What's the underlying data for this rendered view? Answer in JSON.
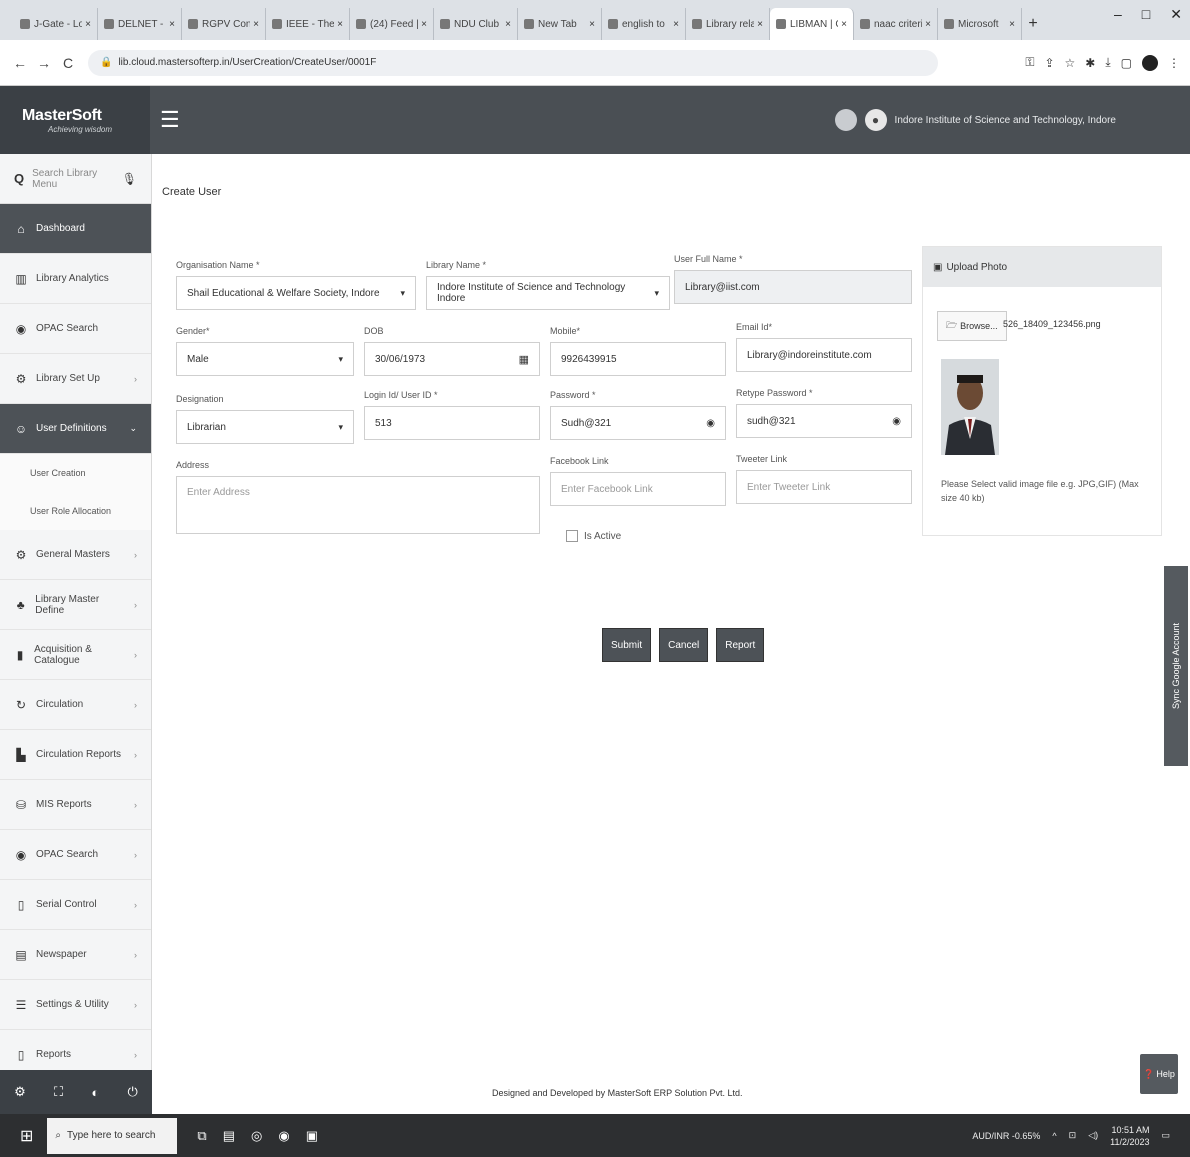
{
  "browser": {
    "tabs": [
      {
        "label": "J-Gate - Lo"
      },
      {
        "label": "DELNET - I"
      },
      {
        "label": "RGPV Cons"
      },
      {
        "label": "IEEE - The"
      },
      {
        "label": "(24) Feed |"
      },
      {
        "label": "NDU Club"
      },
      {
        "label": "New Tab"
      },
      {
        "label": "english to"
      },
      {
        "label": "Library rela"
      },
      {
        "label": "LIBMAN | C"
      },
      {
        "label": "naac criteri"
      },
      {
        "label": "Microsoft"
      }
    ],
    "active_tab_index": 9,
    "url": "lib.cloud.mastersofterp.in/UserCreation/CreateUser/0001F"
  },
  "header": {
    "brand": "MasterSoft",
    "tagline": "Achieving wisdom",
    "institute": "Indore Institute of Science and Technology, Indore"
  },
  "sidebar": {
    "search_placeholder": "Search Library Menu",
    "items": [
      {
        "label": "Dashboard",
        "icon": "home-icon"
      },
      {
        "label": "Library Analytics",
        "icon": "chart-icon"
      },
      {
        "label": "OPAC Search",
        "icon": "search-icon"
      },
      {
        "label": "Library Set Up",
        "icon": "settings-icon"
      },
      {
        "label": "User Definitions",
        "icon": "user-icon"
      },
      {
        "label": "General Masters",
        "icon": "gear-icon"
      },
      {
        "label": "Library Master Define",
        "icon": "users-icon"
      },
      {
        "label": "Acquisition & Catalogue",
        "icon": "book-icon"
      },
      {
        "label": "Circulation",
        "icon": "refresh-icon"
      },
      {
        "label": "Circulation Reports",
        "icon": "bar-chart-icon"
      },
      {
        "label": "MIS Reports",
        "icon": "database-icon"
      },
      {
        "label": "OPAC Search",
        "icon": "search-icon"
      },
      {
        "label": "Serial Control",
        "icon": "document-icon"
      },
      {
        "label": "Newspaper",
        "icon": "newspaper-icon"
      },
      {
        "label": "Settings & Utility",
        "icon": "sliders-icon"
      },
      {
        "label": "Reports",
        "icon": "report-icon"
      }
    ],
    "sub_items": [
      {
        "label": "User Creation"
      },
      {
        "label": "User Role Allocation"
      }
    ]
  },
  "page": {
    "title": "Create User"
  },
  "form": {
    "org_label": "Organisation Name *",
    "org_value": "Shail Educational & Welfare Society, Indore",
    "library_label": "Library Name *",
    "library_value": "Indore Institute of Science and Technology Indore",
    "fullname_label": "User Full Name *",
    "fullname_value": "Library@iist.com",
    "gender_label": "Gender*",
    "gender_value": "Male",
    "dob_label": "DOB",
    "dob_value": "30/06/1973",
    "mobile_label": "Mobile*",
    "mobile_value": "9926439915",
    "email_label": "Email Id*",
    "email_value": "Library@indoreinstitute.com",
    "designation_label": "Designation",
    "designation_value": "Librarian",
    "loginid_label": "Login Id/ User ID *",
    "loginid_value": "513",
    "password_label": "Password *",
    "password_value": "Sudh@321",
    "retype_label": "Retype Password *",
    "retype_value": "sudh@321",
    "address_label": "Address",
    "address_placeholder": "Enter Address",
    "facebook_label": "Facebook Link",
    "facebook_placeholder": "Enter Facebook Link",
    "twitter_label": "Tweeter Link",
    "twitter_placeholder": "Enter Tweeter Link",
    "active_label": "Is Active"
  },
  "upload": {
    "header": "Upload Photo",
    "browse_label": "Browse...",
    "file_name": "526_18409_123456.png",
    "note": "Please Select valid image file e.g. JPG,GIF) (Max size 40 kb)"
  },
  "buttons": {
    "submit": "Submit",
    "cancel": "Cancel",
    "report": "Report"
  },
  "footer": {
    "text": "Designed and Developed by MasterSoft ERP Solution Pvt. Ltd."
  },
  "sync_tab": "Sync Google Account",
  "help": "Help",
  "taskbar": {
    "search_placeholder": "Type here to search",
    "currency": "AUD/INR -0.65%",
    "time": "10:51 AM",
    "date": "11/2/2023"
  },
  "colors": {
    "header_bg": "#4a4f54",
    "sidebar_dark": "#4d5257",
    "button_bg": "#4d5257"
  }
}
